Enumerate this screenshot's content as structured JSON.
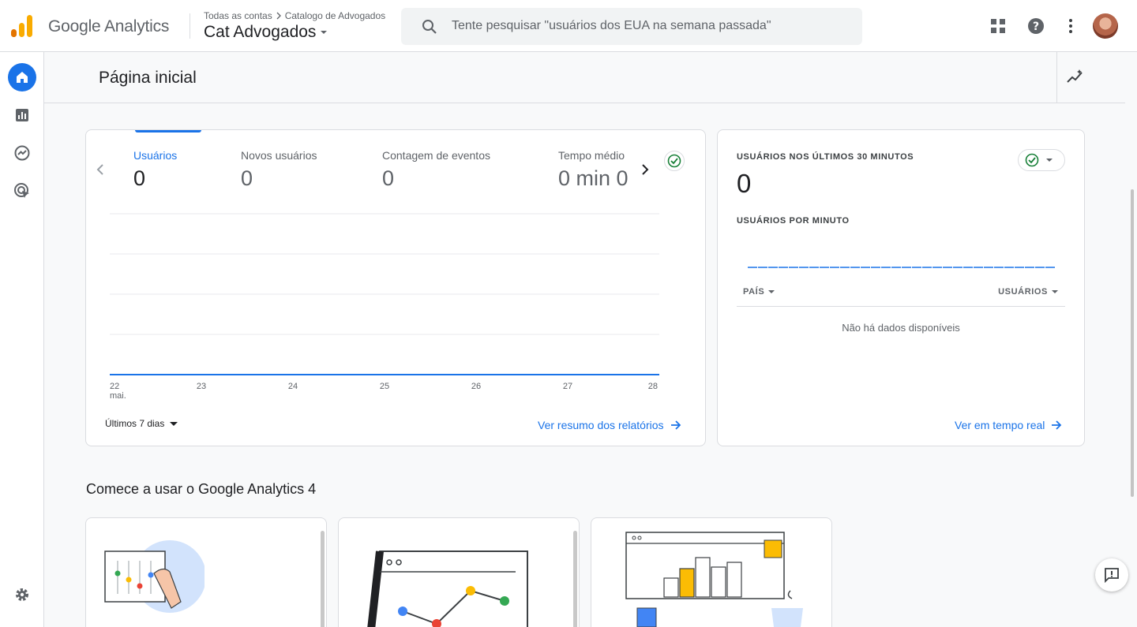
{
  "header": {
    "product_name": "Google Analytics",
    "breadcrumb_account": "Todas as contas",
    "breadcrumb_property": "Catalogo de Advogados",
    "property_name": "Cat Advogados",
    "search_placeholder": "Tente pesquisar \"usuários dos EUA na semana passada\"",
    "icons": [
      "apps-grid-icon",
      "help-icon",
      "more-vert-icon"
    ]
  },
  "sidebar": {
    "items": [
      {
        "icon": "home-icon",
        "active": true
      },
      {
        "icon": "reports-icon",
        "active": false
      },
      {
        "icon": "explore-icon",
        "active": false
      },
      {
        "icon": "advertising-icon",
        "active": false
      }
    ],
    "settings_icon": "settings-icon"
  },
  "page": {
    "title": "Página inicial"
  },
  "overview": {
    "metrics": [
      {
        "label": "Usuários",
        "value": "0"
      },
      {
        "label": "Novos usuários",
        "value": "0"
      },
      {
        "label": "Contagem de eventos",
        "value": "0"
      },
      {
        "label": "Tempo médio",
        "value": "0 min 0"
      }
    ],
    "date_range": "Últimos 7 dias",
    "link": "Ver resumo dos relatórios"
  },
  "chart_data": {
    "type": "line",
    "x": [
      "22",
      "23",
      "24",
      "25",
      "26",
      "27",
      "28"
    ],
    "x_sub": "mai.",
    "series": [
      {
        "name": "Usuários",
        "values": [
          0,
          0,
          0,
          0,
          0,
          0,
          0
        ]
      }
    ],
    "grid": true,
    "color": "#1a73e8"
  },
  "realtime": {
    "title": "USUÁRIOS NOS ÚLTIMOS 30 MINUTOS",
    "value": "0",
    "per_minute_label": "USUÁRIOS POR MINUTO",
    "col_country": "PAÍS",
    "col_users": "USUÁRIOS",
    "no_data": "Não há dados disponíveis",
    "link": "Ver em tempo real"
  },
  "getting_started": {
    "title": "Comece a usar o Google Analytics 4"
  },
  "colors": {
    "accent": "#1a73e8",
    "success": "#188038"
  }
}
